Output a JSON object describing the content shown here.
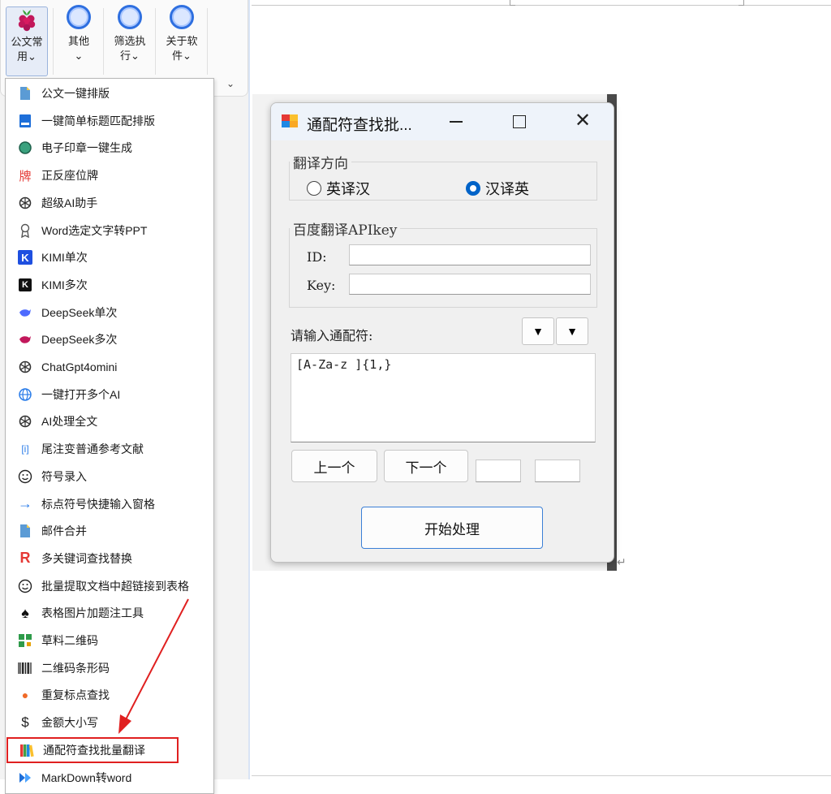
{
  "ribbon": {
    "buttons": [
      {
        "label": "公文常用",
        "chevron": "⌄"
      },
      {
        "label": "其他",
        "chevron": "⌄"
      },
      {
        "label": "筛选执行",
        "chevron": "⌄"
      },
      {
        "label": "关于软件",
        "chevron": "⌄"
      }
    ],
    "collapse_glyph": "⌄"
  },
  "menu": {
    "items": [
      {
        "label": "公文一键排版",
        "icon": "document-icon"
      },
      {
        "label": "一键简单标题匹配排版",
        "icon": "title-icon"
      },
      {
        "label": "电子印章一键生成",
        "icon": "seal-icon"
      },
      {
        "label": "正反座位牌",
        "icon": "nameplate-icon",
        "glyph": "牌"
      },
      {
        "label": "超级AI助手",
        "icon": "openai-icon"
      },
      {
        "label": "Word选定文字转PPT",
        "icon": "ribbon-award-icon"
      },
      {
        "label": "KIMI单次",
        "icon": "kimi-icon",
        "glyph": "K"
      },
      {
        "label": "KIMI多次",
        "icon": "kimi-dark-icon",
        "glyph": "K"
      },
      {
        "label": "DeepSeek单次",
        "icon": "deepseek-icon"
      },
      {
        "label": "DeepSeek多次",
        "icon": "deepseek-multi-icon"
      },
      {
        "label": "ChatGpt4omini",
        "icon": "openai-icon"
      },
      {
        "label": "一键打开多个AI",
        "icon": "globe-icon"
      },
      {
        "label": "AI处理全文",
        "icon": "openai-icon"
      },
      {
        "label": "尾注变普通参考文献",
        "icon": "info-bracket-icon",
        "glyph": "[i]"
      },
      {
        "label": "符号录入",
        "icon": "smiley-icon"
      },
      {
        "label": "标点符号快捷输入窗格",
        "icon": "arrow-right-icon",
        "glyph": "→"
      },
      {
        "label": "邮件合并",
        "icon": "document-icon"
      },
      {
        "label": "多关键词查找替换",
        "icon": "r-letter-icon",
        "glyph": "R"
      },
      {
        "label": "批量提取文档中超链接到表格",
        "icon": "smiley-icon"
      },
      {
        "label": "表格图片加题注工具",
        "icon": "spade-icon",
        "glyph": "♠"
      },
      {
        "label": "草料二维码",
        "icon": "qrcode-icon"
      },
      {
        "label": "二维码条形码",
        "icon": "barcode-icon"
      },
      {
        "label": "重复标点查找",
        "icon": "dot-icon",
        "glyph": "●"
      },
      {
        "label": "金额大小写",
        "icon": "dollar-icon",
        "glyph": "$"
      },
      {
        "label": "通配符查找批量翻译",
        "icon": "books-icon"
      },
      {
        "label": "MarkDown转word",
        "icon": "markdown-icon"
      }
    ],
    "highlighted_index": 24
  },
  "dialog": {
    "title": "通配符查找批...",
    "direction_legend": "翻译方向",
    "radio_en_zh": "英译汉",
    "radio_zh_en": "汉译英",
    "selected": "汉译英",
    "api_legend": "百度翻译APIkey",
    "id_label": "ID:",
    "key_label": "Key:",
    "id_value": "",
    "key_value": "",
    "wildcard_label": "请输入通配符:",
    "dropdown_glyph": "▼",
    "wildcard_text": "[A-Za-z ]{1,}",
    "prev_button": "上一个",
    "next_button": "下一个",
    "box1_value": "",
    "box2_value": "",
    "start_button": "开始处理"
  },
  "colors": {
    "accent": "#2e6fe0",
    "radio_on": "#0063c8",
    "highlight": "#e02020"
  }
}
